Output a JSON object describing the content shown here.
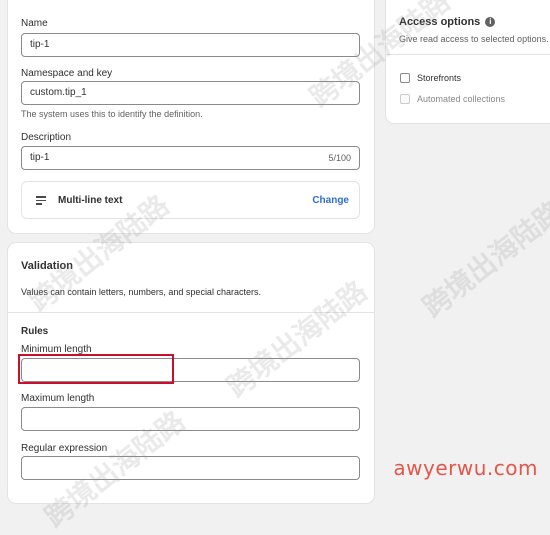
{
  "definition": {
    "name_label": "Name",
    "name_value": "tip-1",
    "namespace_label": "Namespace and key",
    "namespace_value": "custom.tip_1",
    "namespace_help": "The system uses this to identify the definition.",
    "description_label": "Description",
    "description_value": "tip-1",
    "description_counter": "5/100",
    "type_icon": "multiline-text-icon",
    "type_label": "Multi-line text",
    "change_label": "Change"
  },
  "validation": {
    "title": "Validation",
    "description": "Values can contain letters, numbers, and special characters.",
    "rules_title": "Rules",
    "min_length_label": "Minimum length",
    "min_length_value": "",
    "max_length_label": "Maximum length",
    "max_length_value": "",
    "regex_label": "Regular expression",
    "regex_value": ""
  },
  "access_options": {
    "title": "Access options",
    "info_icon": "info-icon",
    "subtitle": "Give read access to selected options.",
    "options": [
      {
        "label": "Storefronts",
        "checked": false,
        "disabled": false
      },
      {
        "label": "Automated collections",
        "checked": false,
        "disabled": true
      }
    ]
  },
  "watermark": {
    "text": "跨境出海陆路",
    "site": "awyerwu.com"
  },
  "colors": {
    "highlight": "#c8102e",
    "link": "#2c6ecb",
    "site": "#e2574c"
  }
}
